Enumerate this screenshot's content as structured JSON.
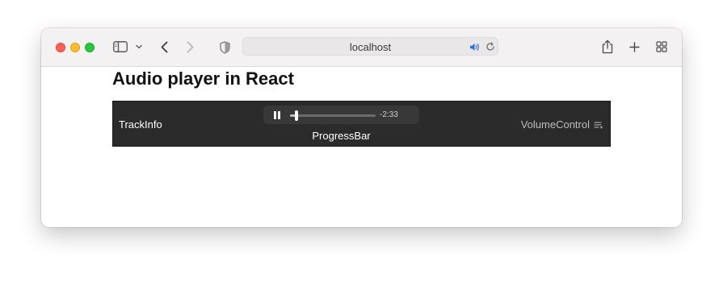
{
  "browser": {
    "address": "localhost",
    "icons": [
      "sidebar-icon",
      "chevron-down-icon",
      "back-icon",
      "forward-icon",
      "shield-icon",
      "speaker-icon",
      "reload-icon",
      "share-icon",
      "plus-icon",
      "tab-overview-icon"
    ]
  },
  "page": {
    "title": "Audio player in React"
  },
  "player": {
    "track_info": "TrackInfo",
    "progress_label": "ProgressBar",
    "volume_label": "VolumeControl",
    "time_remaining": "-2:33",
    "progress_fraction": 0.08,
    "state": "playing",
    "colors": {
      "background": "#2b2b2b",
      "control_pill": "#383838"
    }
  }
}
